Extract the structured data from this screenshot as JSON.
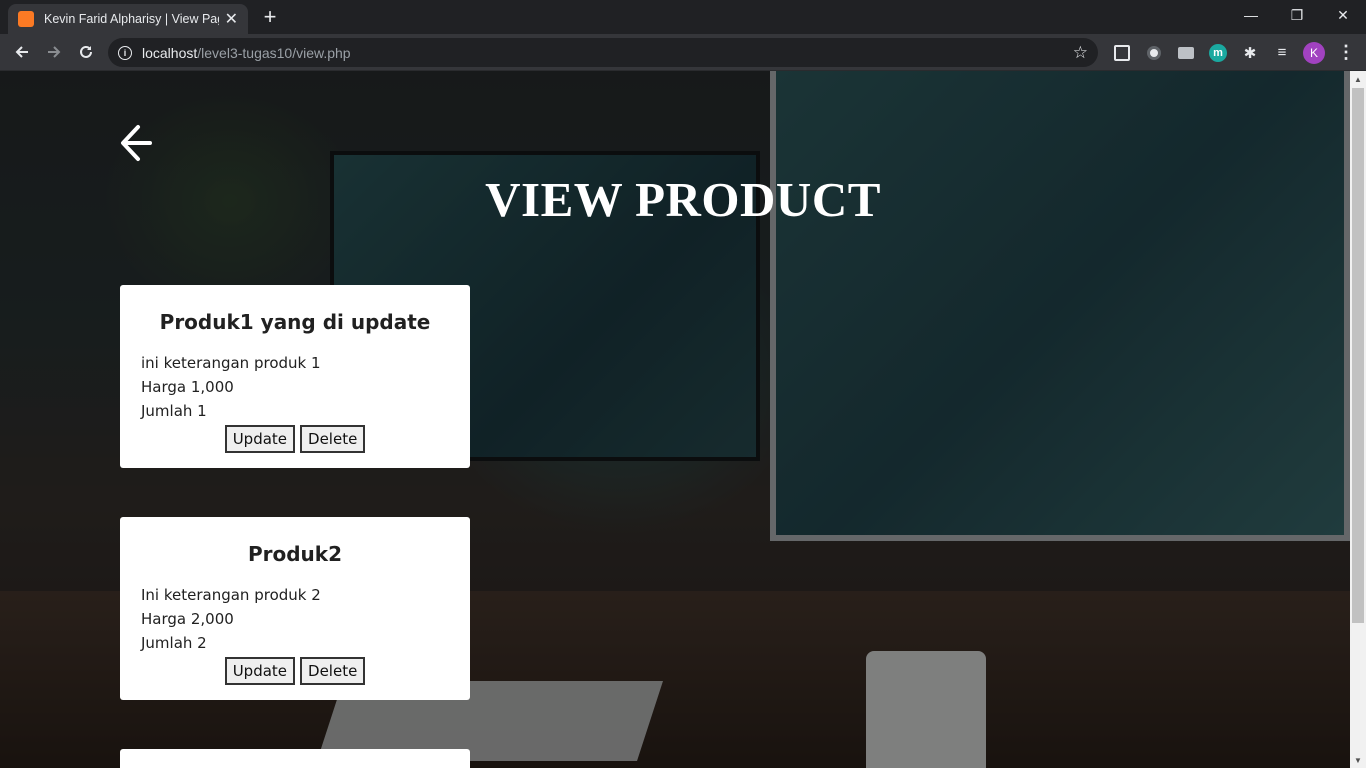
{
  "browser": {
    "tab_title": "Kevin Farid Alpharisy | View Page",
    "tab_close": "✕",
    "new_tab": "+",
    "url_host": "localhost",
    "url_path": "/level3-tugas10/view.php",
    "avatar_letter": "K",
    "ext_m_letter": "m",
    "window_controls": {
      "minimize": "—",
      "restore": "❐",
      "close": "✕"
    }
  },
  "page": {
    "title": "VIEW PRODUCT",
    "update_label": "Update",
    "delete_label": "Delete",
    "products": [
      {
        "name": "Produk1 yang di update",
        "description": "ini keterangan produk 1",
        "price_text": "Harga 1,000",
        "qty_text": "Jumlah 1"
      },
      {
        "name": "Produk2",
        "description": "Ini keterangan produk 2",
        "price_text": "Harga 2,000",
        "qty_text": "Jumlah 2"
      }
    ]
  },
  "icons": {
    "back": "back-arrow-icon",
    "forward": "forward-arrow-icon",
    "reload": "reload-icon",
    "info": "info-icon",
    "star": "star-icon"
  },
  "colors": {
    "chrome_dark": "#202124",
    "chrome_toolbar": "#35363a",
    "card_bg": "#ffffff",
    "title_color": "#ffffff",
    "favicon": "#fb7a24",
    "avatar": "#a142c0"
  }
}
